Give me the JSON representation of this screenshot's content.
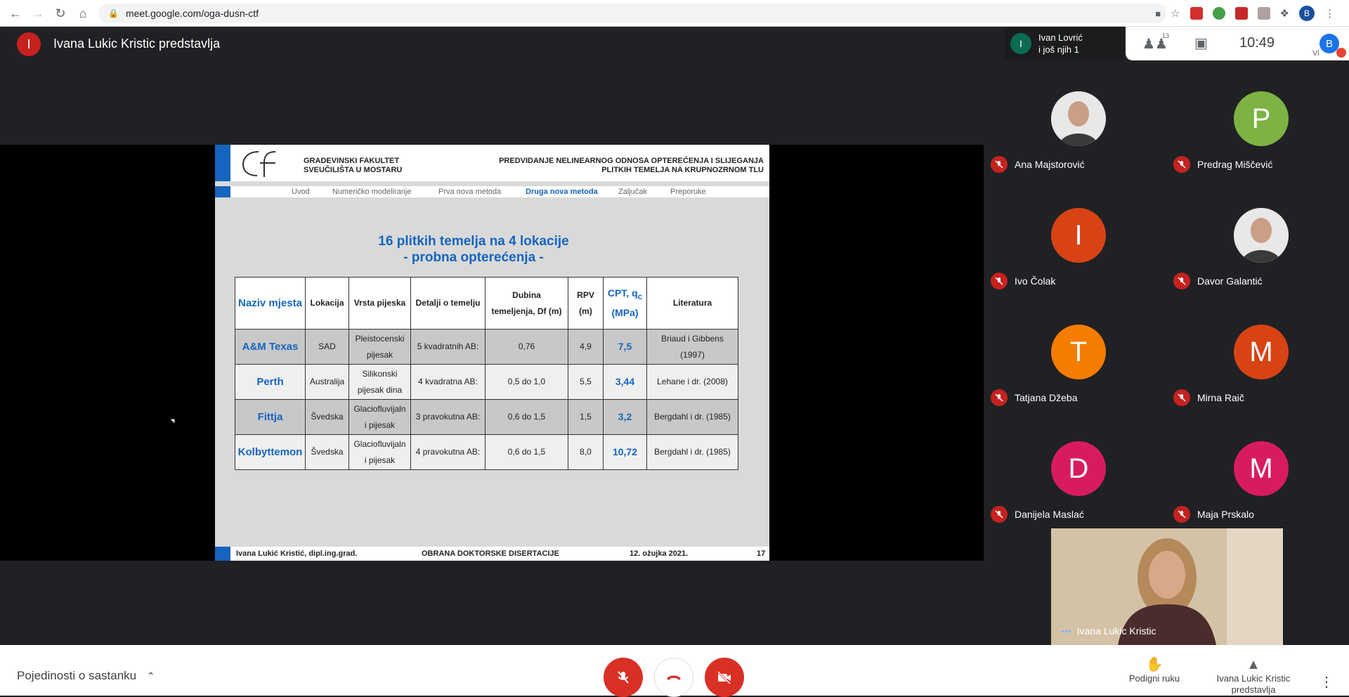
{
  "browser": {
    "url": "meet.google.com/oga-dusn-ctf",
    "profile_letter": "B"
  },
  "meet": {
    "presenter_initial": "I",
    "presenter_title": "Ivana Lukic Kristic predstavlja",
    "pill": {
      "initial": "I",
      "line1": "Ivan Lovrić",
      "line2": "i još njih 1"
    },
    "people_count": "13",
    "clock": "10:49",
    "you_initial": "B",
    "you_label": "Vi"
  },
  "slide": {
    "faculty_line1": "GRADEVINSKI FAKULTET",
    "faculty_line2": "SVEUČILIŠTA U MOSTARU",
    "title_line1": "PREDVIDANJE NELINEARNOG ODNOSA OPTEREĆENJA I SLIJEGANJA",
    "title_line2": "PLITKIH TEMELJA NA KRUPNOZRNOM TLU",
    "nav": [
      "Uvod",
      "Numeričko modeliranje",
      "Prva nova metoda",
      "Druga nova metoda",
      "Zaljučak",
      "Preporuke"
    ],
    "heading_line1": "16 plitkih temelja na 4 lokacije",
    "heading_line2": "- probna opterećenja -",
    "table": {
      "headers": {
        "site": "Naziv mjesta",
        "location": "Lokacija",
        "sand": "Vrsta pijeska",
        "details": "Detalji o temelju",
        "depth1": "Dubina",
        "depth2": "temeljenja, Df (m)",
        "rpv1": "RPV",
        "rpv2": "(m)",
        "cpt1": "CPT, q",
        "cpt_sub": "c",
        "cpt2": "(MPa)",
        "lit": "Literatura"
      },
      "rows": [
        {
          "site": "A&M Texas",
          "location": "SAD",
          "sand1": "Pleistocenski",
          "sand2": "pijesak",
          "details": "5 kvadratnih AB:",
          "depth": "0,76",
          "rpv": "4,9",
          "cpt": "7,5",
          "lit1": "Briaud i Gibbens",
          "lit2": "(1997)"
        },
        {
          "site": "Perth",
          "location": "Australija",
          "sand1": "Silikonski",
          "sand2": "pijesak dina",
          "details": "4 kvadratna AB:",
          "depth": "0,5 do 1,0",
          "rpv": "5,5",
          "cpt": "3,44",
          "lit1": "Lehane i dr. (2008)",
          "lit2": ""
        },
        {
          "site": "Fittja",
          "location": "Švedska",
          "sand1": "Glaciofluvijaln",
          "sand2": "i pijesak",
          "details": "3 pravokutna AB:",
          "depth": "0,6 do 1,5",
          "rpv": "1,5",
          "cpt": "3,2",
          "lit1": "Bergdahl i dr. (1985)",
          "lit2": ""
        },
        {
          "site": "Kolbyttemon",
          "location": "Švedska",
          "sand1": "Glaciofluvijaln",
          "sand2": "i pijesak",
          "details": "4 pravokutna AB:",
          "depth": "0,6 do 1,5",
          "rpv": "8,0",
          "cpt": "10,72",
          "lit1": "Bergdahl i dr. (1985)",
          "lit2": ""
        }
      ]
    },
    "footer": {
      "author": "Ivana Lukić Kristić, dipl.ing.grad.",
      "event": "OBRANA DOKTORSKE DISERTACIJE",
      "date": "12. ožujka 2021.",
      "page": "17"
    }
  },
  "participants": [
    {
      "name": "Ana Majstorović",
      "initial": "",
      "color": "#6b6b6b",
      "photo": true
    },
    {
      "name": "Predrag Miščević",
      "initial": "P",
      "color": "#7cb342",
      "photo": false
    },
    {
      "name": "Ivo Čolak",
      "initial": "I",
      "color": "#d84315",
      "photo": false
    },
    {
      "name": "Davor Galantić",
      "initial": "",
      "color": "#9e9e9e",
      "photo": true
    },
    {
      "name": "Tatjana Džeba",
      "initial": "T",
      "color": "#f57c00",
      "photo": false
    },
    {
      "name": "Mirna Raič",
      "initial": "M",
      "color": "#d84315",
      "photo": false
    },
    {
      "name": "Danijela Maslać",
      "initial": "D",
      "color": "#d81b60",
      "photo": false
    },
    {
      "name": "Maja Prskalo",
      "initial": "M",
      "color": "#d81b60",
      "photo": false
    }
  ],
  "self_view": {
    "name": "Ivana Lukic Kristic"
  },
  "bottom": {
    "meeting_details": "Pojedinosti o sastanku",
    "raise_hand": "Podigni ruku",
    "presenting_line1": "Ivana Lukic Kristic",
    "presenting_line2": "predstavlja"
  },
  "colors": {
    "accent": "#1565c0",
    "danger": "#d93025",
    "bg_dark": "#202124"
  }
}
